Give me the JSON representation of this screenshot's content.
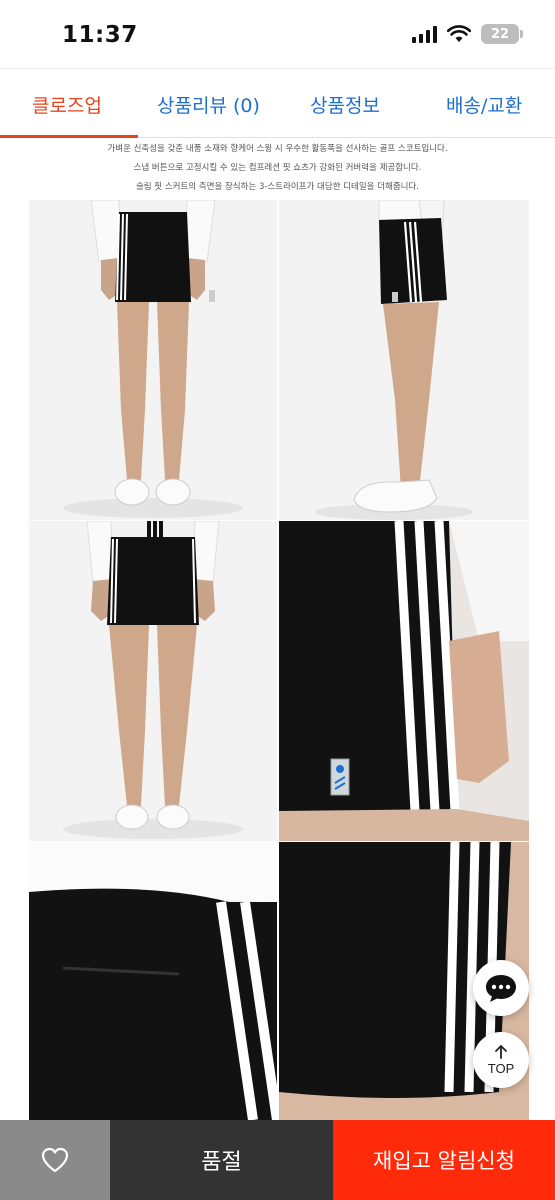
{
  "status": {
    "time": "11:37",
    "battery": "22"
  },
  "tabs": [
    {
      "label": "클로즈업",
      "active": true
    },
    {
      "label": "상품리뷰 (0)",
      "active": false
    },
    {
      "label": "상품정보",
      "active": false
    },
    {
      "label": "배송/교환",
      "active": false
    }
  ],
  "description": {
    "line1": "가벼운 신축성을 갖춘 내풍 소재와 향케어 스윙 시 우수한 활동폭을 선사하는 골프 스코트입니다.",
    "line2": "스냅 버튼으로 고정시킬 수 있는 컴프레션 핏 쇼츠가 강화된 커버력을 제공합니다.",
    "line3": "슬림 핏 스커트의 측면을 장식하는 3-스트라이프가 대담한 디테일을 더해줍니다."
  },
  "photos": [
    {
      "name": "front-full"
    },
    {
      "name": "side-full"
    },
    {
      "name": "back-full"
    },
    {
      "name": "side-closeup"
    },
    {
      "name": "back-pocket-closeup"
    },
    {
      "name": "stripe-closeup"
    }
  ],
  "floating": {
    "chat_icon": "chat-bubble-icon",
    "top_label": "TOP"
  },
  "bottom_bar": {
    "wish_icon": "heart-icon",
    "soldout_label": "품절",
    "restock_label": "재입고 알림신청"
  },
  "colors": {
    "active_tab": "#e8431c",
    "tab": "#1f6fd1",
    "restock": "#ff2a0a",
    "soldout": "#333333",
    "wish": "#8a8a8a"
  }
}
